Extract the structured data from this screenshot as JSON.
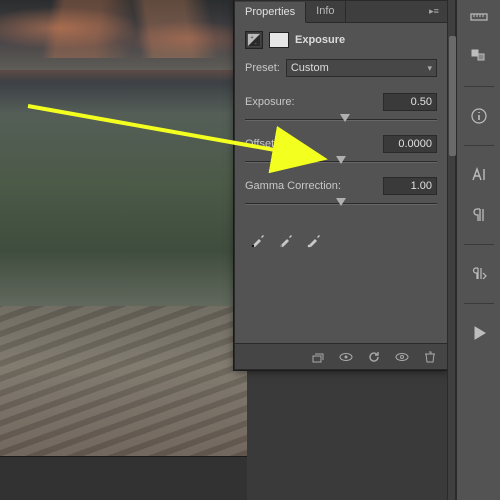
{
  "panel": {
    "tabs": {
      "properties": "Properties",
      "info": "Info"
    },
    "title": "Exposure",
    "preset_label": "Preset:",
    "preset_value": "Custom",
    "exposure": {
      "label": "Exposure:",
      "value": "0.50",
      "pos_pct": 52
    },
    "offset": {
      "label": "Offset:",
      "value": "0.0000",
      "pos_pct": 50
    },
    "gamma": {
      "label": "Gamma Correction:",
      "value": "1.00",
      "pos_pct": 50
    }
  },
  "icons": {
    "eyedropper_black": "eyedropper-black",
    "eyedropper_gray": "eyedropper-gray",
    "eyedropper_white": "eyedropper-white"
  },
  "right_toolbar": {
    "items": [
      "ruler",
      "swatches",
      "info",
      "character",
      "paragraph",
      "paragraph-styles",
      "play"
    ]
  }
}
